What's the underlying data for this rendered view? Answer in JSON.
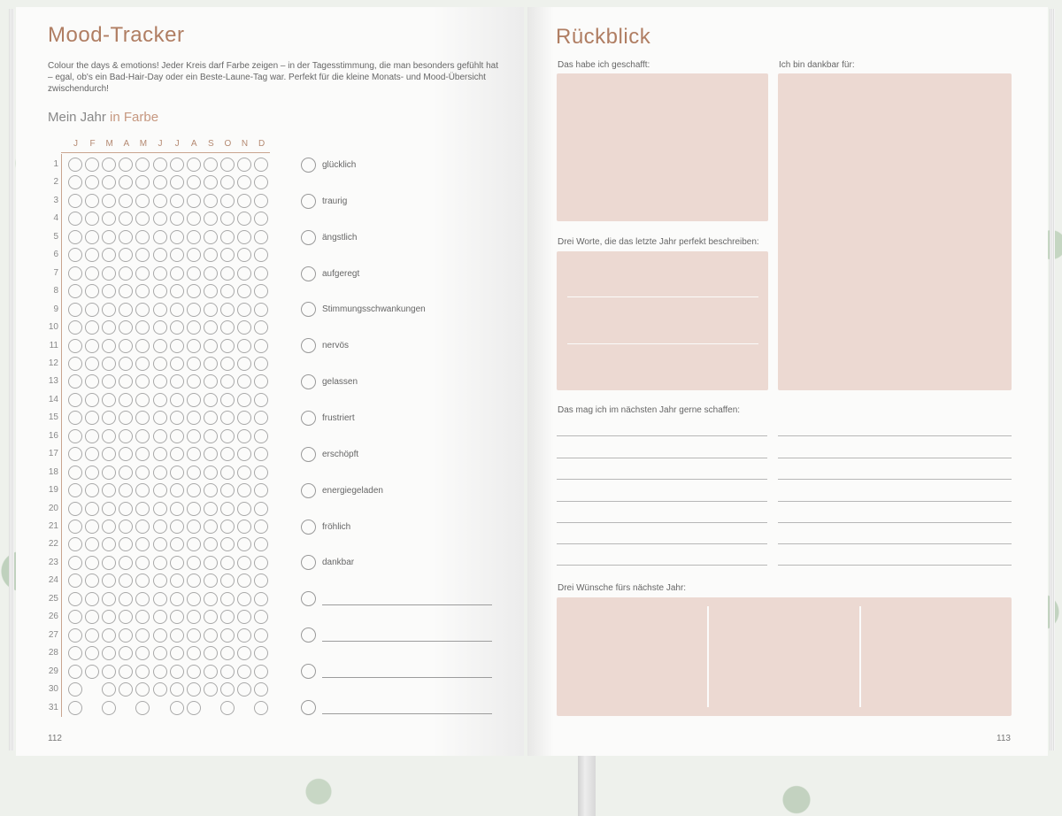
{
  "left_page": {
    "title": "Mood-Tracker",
    "intro": "Colour the days & emotions! Jeder Kreis darf Farbe zeigen – in der Tagesstimmung, die man besonders gefühlt hat – egal, ob's ein Bad-Hair-Day oder ein Beste-Laune-Tag war. Perfekt für die kleine Monats- und Mood-Übersicht zwischendurch!",
    "subtitle_plain": "Mein Jahr",
    "subtitle_accent": "in Farbe",
    "months": [
      "J",
      "F",
      "M",
      "A",
      "M",
      "J",
      "J",
      "A",
      "S",
      "O",
      "N",
      "D"
    ],
    "days": [
      "1",
      "2",
      "3",
      "4",
      "5",
      "6",
      "7",
      "8",
      "9",
      "10",
      "11",
      "12",
      "13",
      "14",
      "15",
      "16",
      "17",
      "18",
      "19",
      "20",
      "21",
      "22",
      "23",
      "24",
      "25",
      "26",
      "27",
      "28",
      "29",
      "30",
      "31"
    ],
    "month_lengths": [
      31,
      29,
      31,
      30,
      31,
      30,
      31,
      31,
      30,
      31,
      30,
      31
    ],
    "moods": [
      "glücklich",
      "traurig",
      "ängstlich",
      "aufgeregt",
      "Stimmungsschwankungen",
      "nervös",
      "gelassen",
      "frustriert",
      "erschöpft",
      "energiegeladen",
      "fröhlich",
      "dankbar"
    ],
    "blank_moods": 4,
    "page_number": "112"
  },
  "right_page": {
    "title": "Rückblick",
    "achieved_label": "Das habe ich geschafft:",
    "grateful_label": "Ich bin dankbar für:",
    "three_words_label": "Drei Worte, die das letzte Jahr perfekt beschreiben:",
    "next_year_label": "Das mag ich im nächsten Jahr gerne schaffen:",
    "wishes_label": "Drei Wünsche fürs nächste Jahr:",
    "page_number": "113"
  },
  "colors": {
    "accent": "#b07e63",
    "box_fill": "#ecd9d2",
    "circle_stroke": "#a9a9a9"
  }
}
